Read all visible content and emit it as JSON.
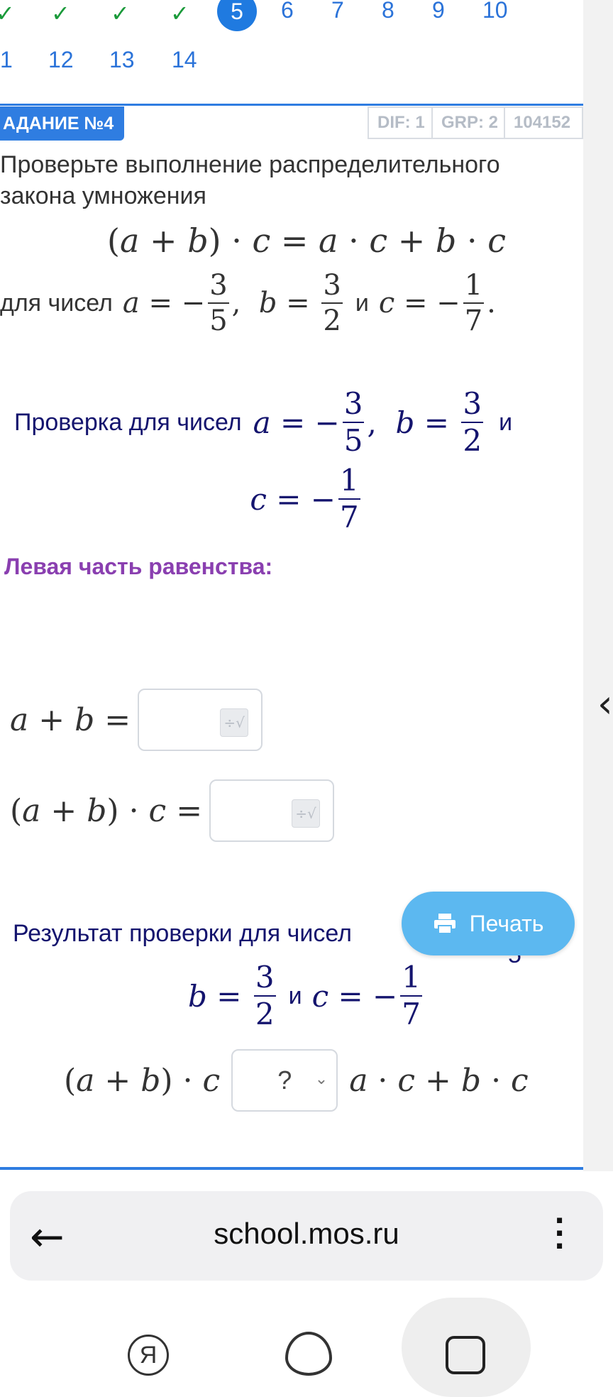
{
  "nav": {
    "current": "5",
    "numbers_row1": [
      "6",
      "7",
      "8",
      "9",
      "10"
    ],
    "numbers_row2": [
      "1",
      "12",
      "13",
      "14"
    ],
    "check_icon": "checkmark-icon"
  },
  "task": {
    "badge": "АДАНИЕ №4",
    "dif": "DIF: 1",
    "grp": "GRP: 2",
    "id": "104152",
    "text": "Проверьте выполнение распределительного закона умножения",
    "for_numbers": "для чисел",
    "and": "и"
  },
  "check": {
    "heading": "Проверка для чисел",
    "and": "и"
  },
  "left_part": "Левая часть равенства:",
  "result": {
    "heading": "Результат проверки для чисел",
    "tail": "5",
    "and": "и",
    "select_value": "?"
  },
  "print_label": "Печать",
  "browser": {
    "url": "school.mos.ru"
  },
  "system_nav": {
    "yandex_label": "Я"
  },
  "colors": {
    "accent": "#2f7de1",
    "check_green": "#1a9a3a",
    "navy": "#14146e",
    "purple": "#8a3fb0",
    "print_button": "#5cb8f0"
  }
}
